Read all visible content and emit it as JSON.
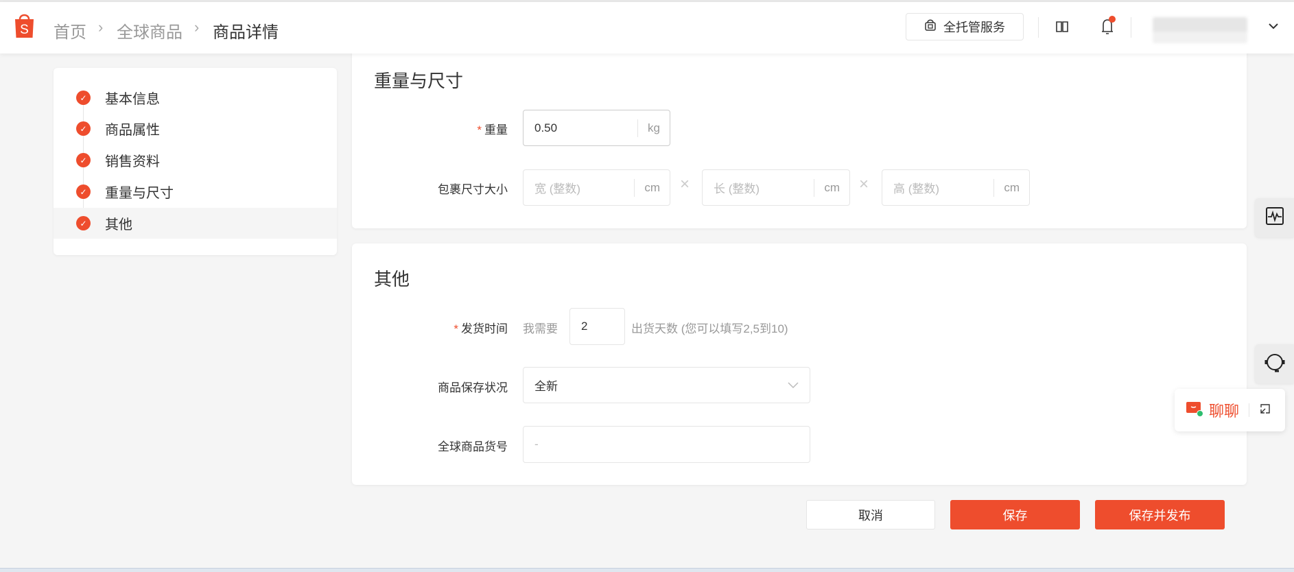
{
  "header": {
    "logo_letter": "S",
    "breadcrumb": [
      "首页",
      "全球商品",
      "商品详情"
    ],
    "service_button": "全托管服务",
    "brand_color": "#ee4d2d"
  },
  "nav": {
    "items": [
      {
        "label": "基本信息"
      },
      {
        "label": "商品属性"
      },
      {
        "label": "销售资料"
      },
      {
        "label": "重量与尺寸"
      },
      {
        "label": "其他"
      }
    ]
  },
  "weight_section": {
    "title": "重量与尺寸",
    "weight_label": "重量",
    "weight_value": "0.50",
    "weight_unit": "kg",
    "size_label": "包裹尺寸大小",
    "width_placeholder": "宽 (整数)",
    "length_placeholder": "长 (整数)",
    "height_placeholder": "高 (整数)",
    "size_unit": "cm"
  },
  "other_section": {
    "title": "其他",
    "ship_label": "发货时间",
    "ship_prefix": "我需要",
    "ship_days": "2",
    "ship_suffix": "出货天数 (您可以填写2,5到10)",
    "condition_label": "商品保存状况",
    "condition_value": "全新",
    "sku_label": "全球商品货号",
    "sku_placeholder": "-"
  },
  "actions": {
    "cancel": "取消",
    "save": "保存",
    "save_publish": "保存并发布"
  },
  "chat": {
    "label": "聊聊"
  }
}
